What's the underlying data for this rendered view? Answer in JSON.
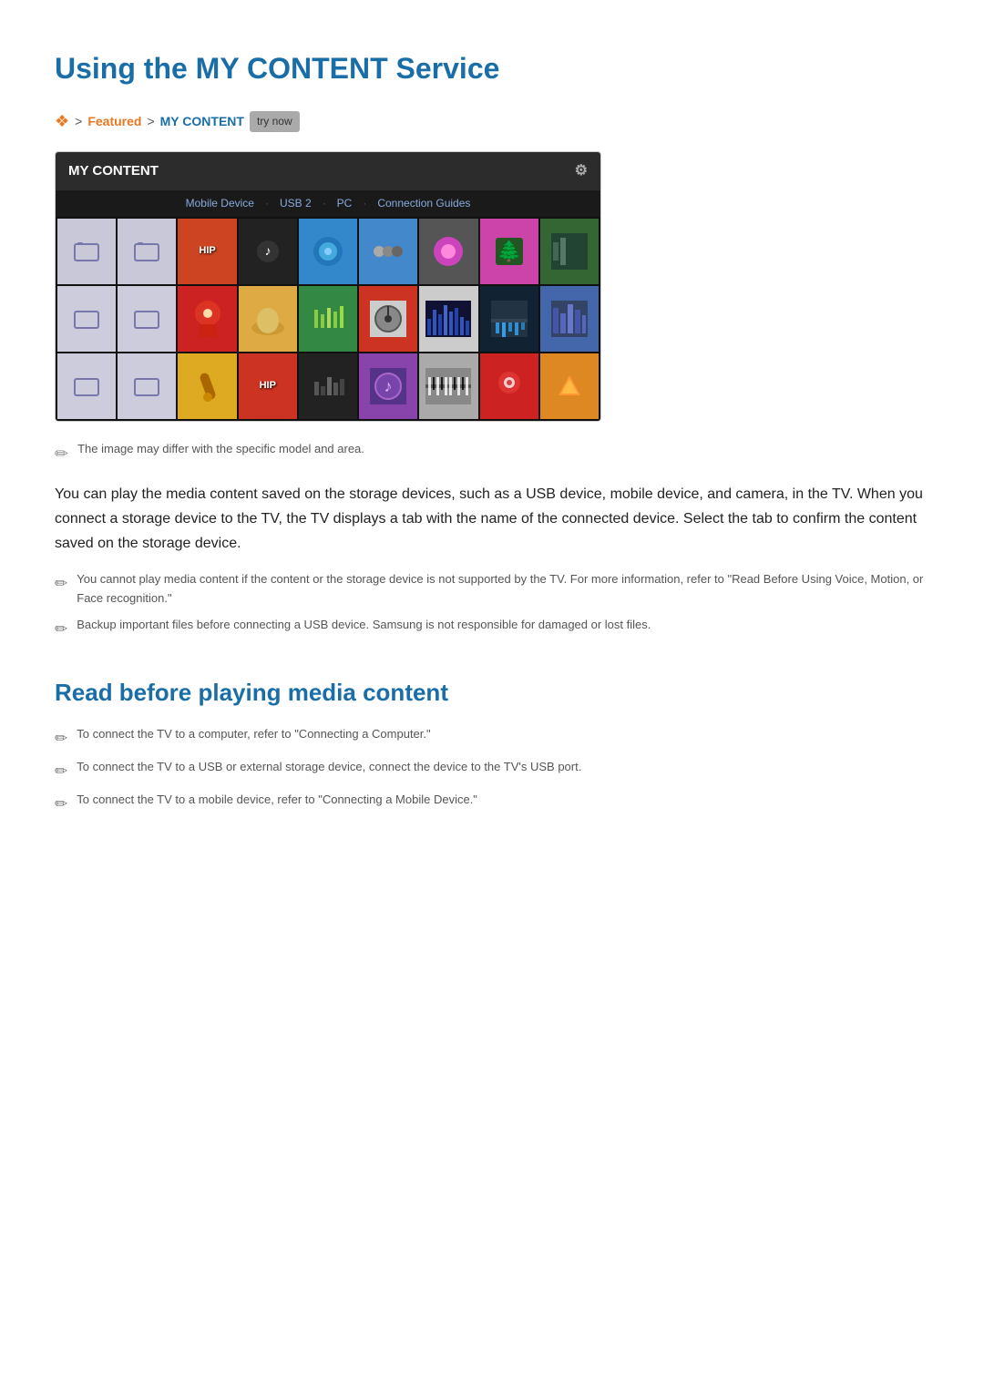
{
  "page": {
    "title": "Using the MY CONTENT Service",
    "breadcrumb": {
      "icon_label": "settings-icon",
      "separator": ">",
      "featured": "Featured",
      "separator2": ">",
      "mycontent": "MY CONTENT",
      "trynow": "try now"
    },
    "panel": {
      "title": "MY CONTENT",
      "gear_label": "⚙",
      "tabs": [
        "Mobile Device",
        "USB 2",
        "PC",
        "Connection Guides"
      ],
      "tabs_dots": [
        "·",
        "·",
        "·"
      ]
    },
    "image_note": "The image may differ with the specific model and area.",
    "intro_text": "You can play the media content saved on the storage devices, such as a USB device, mobile device, and camera, in the TV. When you connect a storage device to the TV, the TV displays a tab with the name of the connected device. Select the tab to confirm the content saved on the storage device.",
    "notes": [
      "You cannot play media content if the content or the storage device is not supported by the TV. For more information, refer to \"Read Before Using Voice, Motion, or Face recognition.\"",
      "Backup important files before connecting a USB device. Samsung is not responsible for damaged or lost files."
    ],
    "section2_title": "Read before playing media content",
    "bullets": [
      "To connect the TV to a computer, refer to \"Connecting a Computer.\"",
      "To connect the TV to a USB or external storage device, connect the device to the TV's USB port.",
      "To connect the TV to a mobile device, refer to \"Connecting a Mobile Device.\""
    ]
  }
}
